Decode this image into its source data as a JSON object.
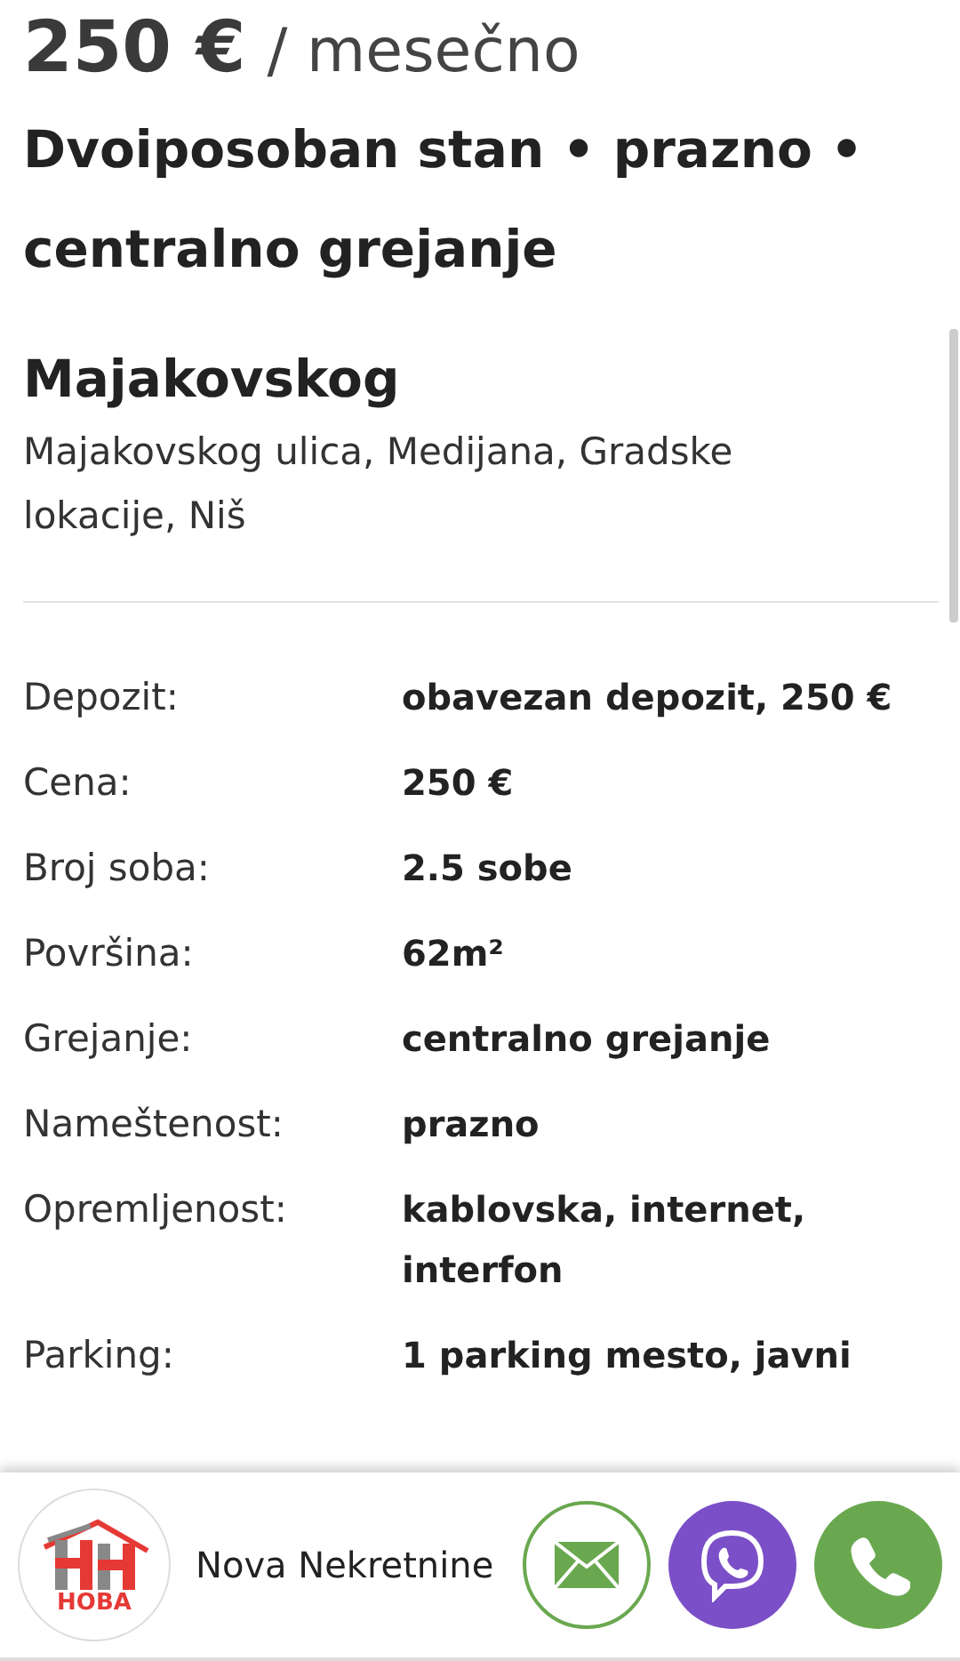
{
  "price": {
    "amount": "250 €",
    "period": "/ mesečno"
  },
  "title": "Dvoiposoban stan • prazno • centralno grejanje",
  "location": {
    "name": "Majakovskog",
    "address": "Majakovskog ulica, Medijana, Gradske lokacije, Niš"
  },
  "details": [
    {
      "label": "Depozit:",
      "value": "obavezan depozit, 250 €"
    },
    {
      "label": "Cena:",
      "value": "250 €"
    },
    {
      "label": "Broj soba:",
      "value": "2.5 sobe"
    },
    {
      "label": "Površina:",
      "value": "62m²"
    },
    {
      "label": "Grejanje:",
      "value": "centralno grejanje"
    },
    {
      "label": "Nameštenost:",
      "value": "prazno"
    },
    {
      "label": "Opremljenost:",
      "value": "kablovska, internet, interfon"
    },
    {
      "label": "Parking:",
      "value": "1 parking mesto, javni"
    }
  ],
  "agency": {
    "logo_text": "НОВА",
    "name": "Nova Nekretnine"
  },
  "contact_buttons": [
    {
      "kind": "email"
    },
    {
      "kind": "viber"
    },
    {
      "kind": "phone"
    }
  ]
}
